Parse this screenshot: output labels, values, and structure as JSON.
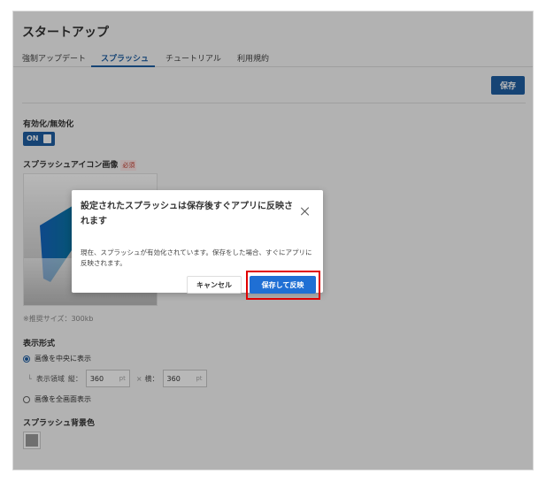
{
  "page": {
    "title": "スタートアップ"
  },
  "tabs": [
    {
      "label": "強制アップデート",
      "active": false
    },
    {
      "label": "スプラッシュ",
      "active": true
    },
    {
      "label": "チュートリアル",
      "active": false
    },
    {
      "label": "利用規約",
      "active": false
    }
  ],
  "toolbar": {
    "save_label": "保存"
  },
  "enable": {
    "label": "有効化/無効化",
    "toggle_text": "ON"
  },
  "splash_icon": {
    "label": "スプラッシュアイコン画像",
    "required_badge": "必須",
    "hint": "※推奨サイズ：300kb"
  },
  "display": {
    "label": "表示形式",
    "option_center": "画像を中央に表示",
    "area_label": "表示領域",
    "vertical_label": "縦：",
    "vertical_value": "360",
    "horizontal_label": "横：",
    "horizontal_value": "360",
    "unit": "pt",
    "times": "×",
    "option_full": "画像を全画面表示"
  },
  "background": {
    "label": "スプラッシュ背景色",
    "color": "#9a9a9a"
  },
  "dialog": {
    "title": "設定されたスプラッシュは保存後すぐアプリに反映されます",
    "body": "現在、スプラッシュが有効化されています。保存をした場合、すぐにアプリに反映されます。",
    "cancel_label": "キャンセル",
    "confirm_label": "保存して反映"
  },
  "colors": {
    "accent": "#1f5fa3",
    "primary_button": "#1f6fd4",
    "highlight": "#e00000"
  }
}
